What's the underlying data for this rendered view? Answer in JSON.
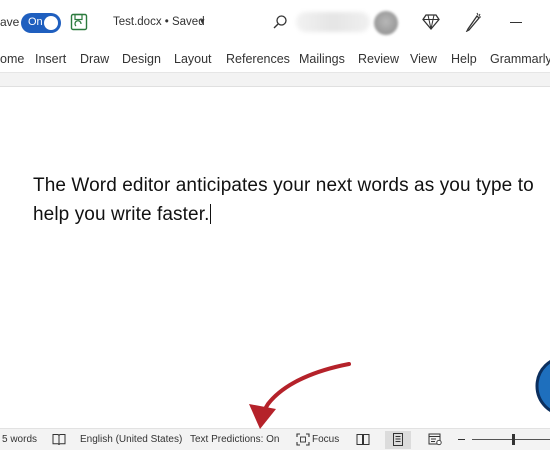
{
  "titlebar": {
    "autosave_label": "ave",
    "autosave_state": "On",
    "document_title": "Test.docx • Saved",
    "title_caret": "▾"
  },
  "ribbon": {
    "tabs": [
      "ome",
      "Insert",
      "Draw",
      "Design",
      "Layout",
      "References",
      "Mailings",
      "Review",
      "View",
      "Help",
      "Grammarly"
    ]
  },
  "document": {
    "line1": "The Word editor anticipates your next words as you type to",
    "line2": "help you write faster."
  },
  "statusbar": {
    "word_count": "5 words",
    "language": "English (United States)",
    "text_predictions": "Text Predictions: On",
    "focus": "Focus"
  },
  "icons": {
    "save": "save-icon",
    "search": "search-icon",
    "premium": "diamond-icon",
    "designer": "pen-icon",
    "minimize": "minimize-icon",
    "proofing": "book-icon",
    "focus": "focus-icon",
    "read_mode": "read-mode-icon",
    "print_layout": "print-layout-icon",
    "web_layout": "web-layout-icon"
  },
  "colors": {
    "accent": "#1f5fbf",
    "annotation_arrow": "#b5222a",
    "annotation_circle": "#1e6fbd"
  }
}
